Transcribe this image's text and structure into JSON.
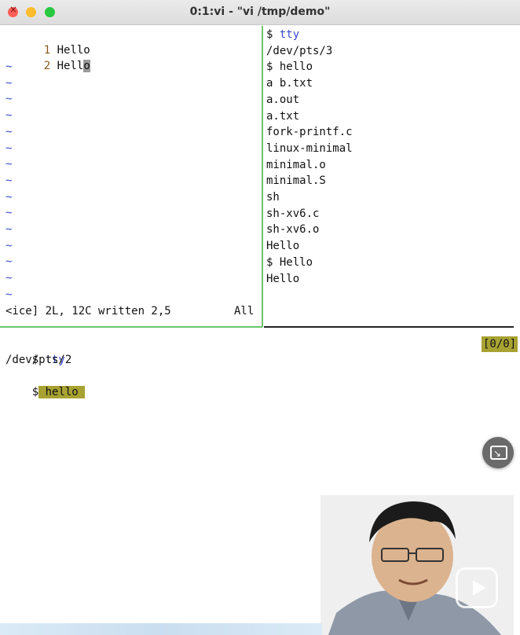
{
  "window": {
    "title": "0:1:vi - \"vi /tmp/demo\""
  },
  "vim": {
    "lines": [
      {
        "num": "1",
        "text": "Hello"
      },
      {
        "num": "2",
        "text_before": "Hell",
        "cursor_char": "o"
      }
    ],
    "tilde": "~",
    "tilde_count": 15,
    "status_left": "<ice] 2L, 12C written 2,5",
    "status_right": "All"
  },
  "right_pane": {
    "prompt": "$ ",
    "lines": [
      {
        "prompt": true,
        "cmd": "tty"
      },
      {
        "text": "/dev/pts/3"
      },
      {
        "prompt": true,
        "cmd": "hello",
        "plain": true
      },
      {
        "text": "a b.txt"
      },
      {
        "text": "a.out"
      },
      {
        "text": "a.txt"
      },
      {
        "text": "fork-printf.c"
      },
      {
        "text": "linux-minimal"
      },
      {
        "text": "minimal.o"
      },
      {
        "text": "minimal.S"
      },
      {
        "text": "sh"
      },
      {
        "text": "sh-xv6.c"
      },
      {
        "text": "sh-xv6.o"
      },
      {
        "text": "Hello"
      },
      {
        "prompt": true,
        "cmd": "Hello",
        "plain": true
      },
      {
        "text": "Hello"
      }
    ]
  },
  "bottom_pane": {
    "line1_prompt": "$ ",
    "line1_cmd": "tty",
    "line2": "/dev/pts/2",
    "line3_prompt": "$",
    "line3_input": " hello ",
    "indicator": "[0/0]"
  },
  "icons": {
    "pip": "picture-in-picture-icon",
    "play": "play-icon"
  },
  "colors": {
    "pane_border_active": "#6cc56c",
    "highlight": "#a8a232",
    "command_blue": "#3a4ad0"
  }
}
